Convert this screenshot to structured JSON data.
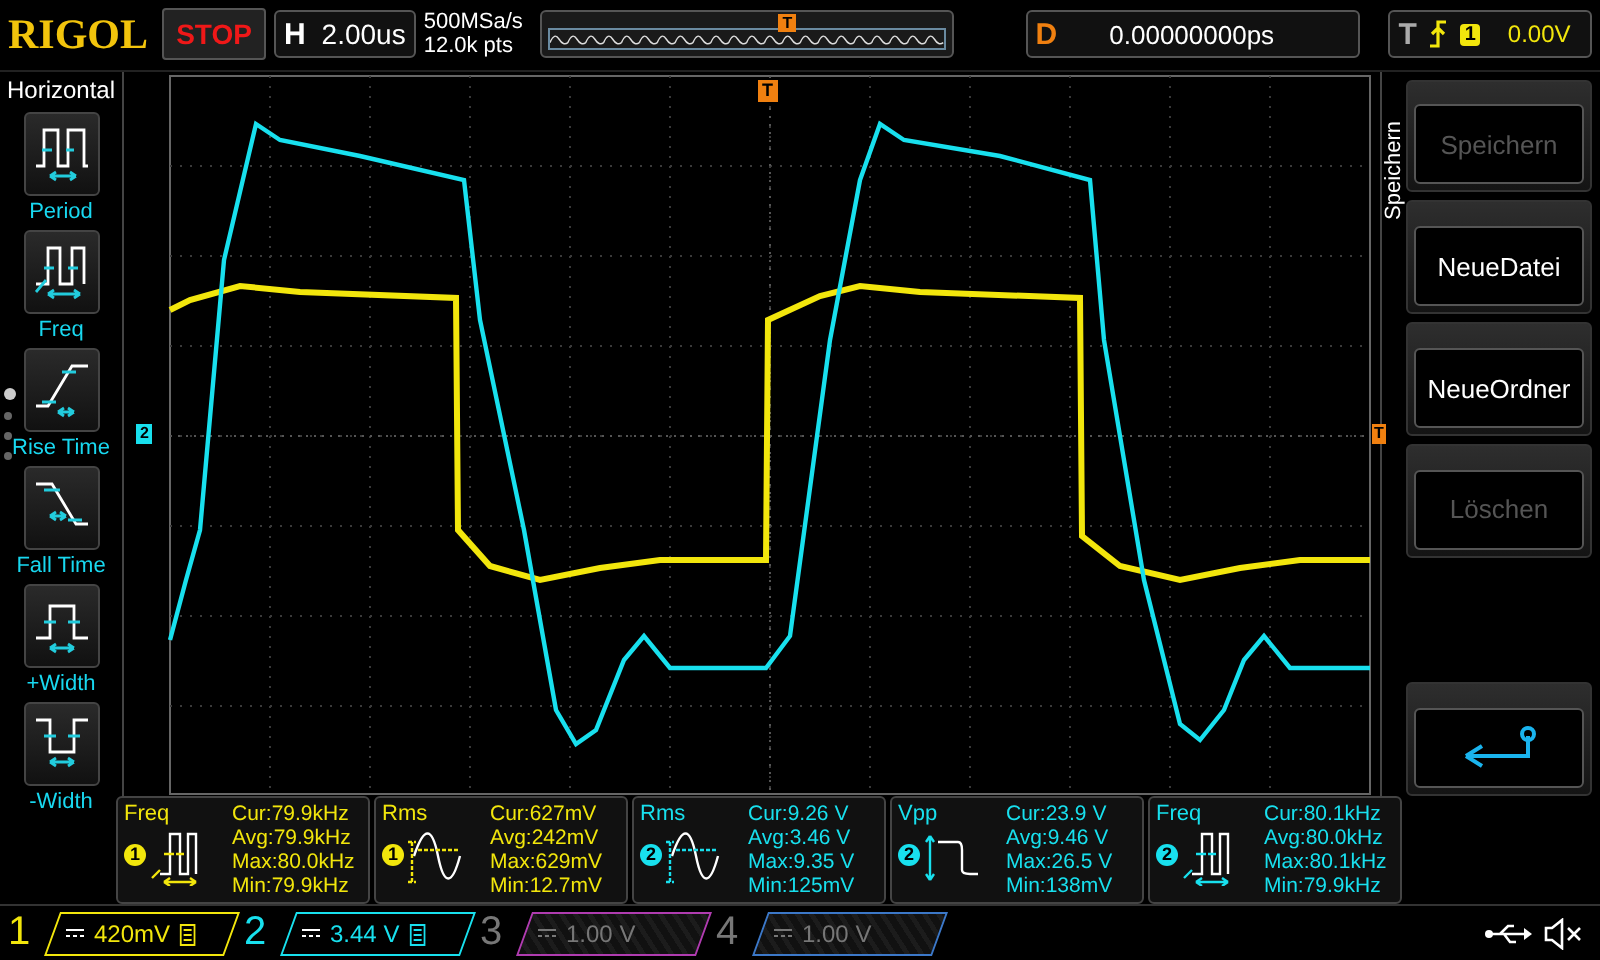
{
  "header": {
    "logo": "RIGOL",
    "run_state": "STOP",
    "horizontal": {
      "label": "H",
      "value": "2.00us"
    },
    "sample_rate": "500MSa/s",
    "memory_depth": "12.0k pts",
    "trigger_position_marker": "T",
    "delay": {
      "label": "D",
      "value": "0.00000000ps"
    },
    "trigger": {
      "label": "T",
      "source": "1",
      "level": "0.00V"
    }
  },
  "left_menu": {
    "title": "Horizontal",
    "page_dots": [
      {
        "selected": true
      },
      {
        "selected": false
      },
      {
        "selected": false
      },
      {
        "selected": false
      }
    ],
    "items": [
      {
        "label": "Period",
        "kind": "period"
      },
      {
        "label": "Freq",
        "kind": "freq"
      },
      {
        "label": "Rise Time",
        "kind": "rise"
      },
      {
        "label": "Fall Time",
        "kind": "fall"
      },
      {
        "label": "+Width",
        "kind": "pwidth"
      },
      {
        "label": "-Width",
        "kind": "nwidth"
      }
    ]
  },
  "plot": {
    "trigger_marker": "T",
    "channel_marker": "2",
    "trigger_level_marker": "T"
  },
  "right_menu": {
    "title": "Speichern",
    "buttons": [
      {
        "kind": "text",
        "label": "Speichern",
        "disabled": true
      },
      {
        "kind": "text",
        "label": "NeueDatei",
        "disabled": false
      },
      {
        "kind": "text",
        "label": "NeueOrdner",
        "disabled": false
      },
      {
        "kind": "text",
        "label": "Löschen",
        "disabled": true
      },
      {
        "kind": "spacer"
      },
      {
        "kind": "back",
        "disabled": false
      }
    ]
  },
  "measurements": [
    {
      "name": "Freq",
      "kind": "freq",
      "channel": "1",
      "color": "#f2e60c",
      "lines": [
        "Cur:79.9kHz",
        "Avg:79.9kHz",
        "Max:80.0kHz",
        "Min:79.9kHz"
      ]
    },
    {
      "name": "Rms",
      "kind": "rms",
      "channel": "1",
      "color": "#f2e60c",
      "lines": [
        "Cur:627mV",
        "Avg:242mV",
        "Max:629mV",
        "Min:12.7mV"
      ]
    },
    {
      "name": "Rms",
      "kind": "rms",
      "channel": "2",
      "color": "#18e0ee",
      "lines": [
        "Cur:9.26 V",
        "Avg:3.46 V",
        "Max:9.35 V",
        "Min:125mV"
      ]
    },
    {
      "name": "Vpp",
      "kind": "vpp",
      "channel": "2",
      "color": "#18e0ee",
      "lines": [
        "Cur:23.9 V",
        "Avg:9.46 V",
        "Max:26.5 V",
        "Min:138mV"
      ]
    },
    {
      "name": "Freq",
      "kind": "freq",
      "channel": "2",
      "color": "#18e0ee",
      "lines": [
        "Cur:80.1kHz",
        "Avg:80.0kHz",
        "Max:80.1kHz",
        "Min:79.9kHz"
      ]
    }
  ],
  "channels": [
    {
      "number": "1",
      "scale": "420mV",
      "enabled": true,
      "color": "#f2e60c"
    },
    {
      "number": "2",
      "scale": "3.44 V",
      "enabled": true,
      "color": "#18e0ee"
    },
    {
      "number": "3",
      "scale": "1.00 V",
      "enabled": false,
      "color": "#b03cb0"
    },
    {
      "number": "4",
      "scale": "1.00 V",
      "enabled": false,
      "color": "#3c78c8"
    }
  ]
}
